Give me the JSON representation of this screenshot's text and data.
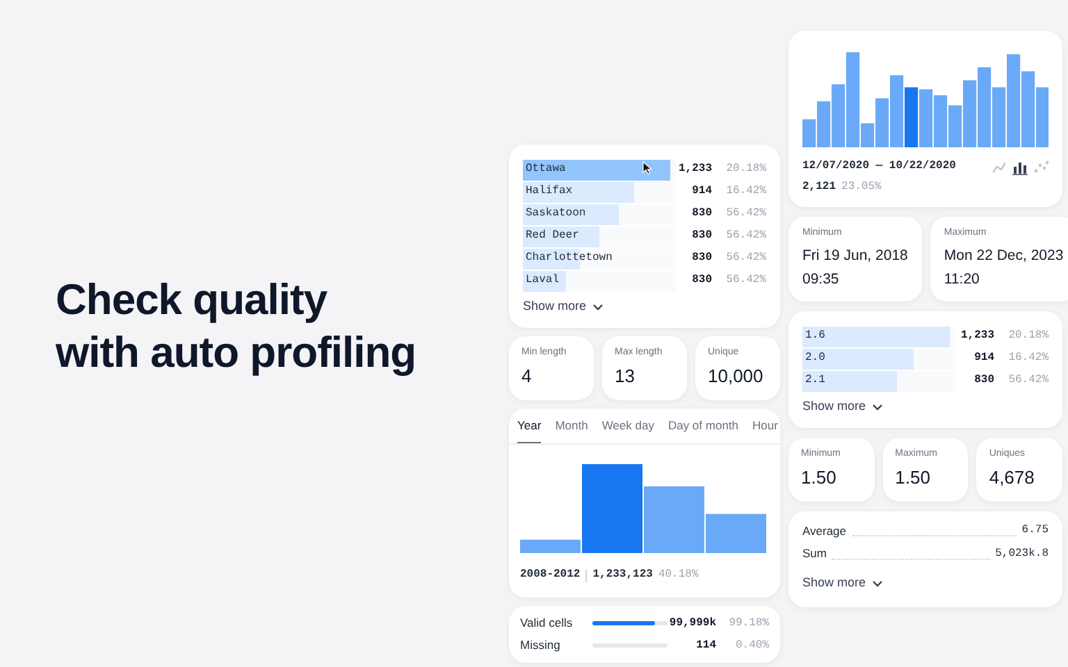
{
  "headline": "Check quality with auto profiling",
  "category_card": {
    "rows": [
      {
        "label": "Ottawa",
        "count": "1,233",
        "percent": "20.18%",
        "level": 0.96,
        "selected": true
      },
      {
        "label": "Halifax",
        "count": "914",
        "percent": "16.42%",
        "level": 0.73,
        "selected": false
      },
      {
        "label": "Saskatoon",
        "count": "830",
        "percent": "56.42%",
        "level": 0.63,
        "selected": false
      },
      {
        "label": "Red Deer",
        "count": "830",
        "percent": "56.42%",
        "level": 0.5,
        "selected": false
      },
      {
        "label": "Charlottetown",
        "count": "830",
        "percent": "56.42%",
        "level": 0.37,
        "selected": false
      },
      {
        "label": "Laval",
        "count": "830",
        "percent": "56.42%",
        "level": 0.28,
        "selected": false
      }
    ],
    "show_more": "Show more"
  },
  "text_stats": [
    {
      "label": "Min length",
      "value": "4"
    },
    {
      "label": "Max length",
      "value": "13"
    },
    {
      "label": "Unique",
      "value": "10,000"
    }
  ],
  "date_histogram": {
    "tabs": [
      {
        "label": "Year",
        "selected": true
      },
      {
        "label": "Month",
        "selected": false
      },
      {
        "label": "Week day",
        "selected": false
      },
      {
        "label": "Day of month",
        "selected": false
      },
      {
        "label": "Hour",
        "selected": false
      }
    ],
    "range": "2008-2012",
    "count": "1,233,123",
    "percent": "40.18%"
  },
  "validity": [
    {
      "label": "Valid cells",
      "count": "99,999k",
      "percent": "99.18%",
      "level": 0.83
    },
    {
      "label": "Missing",
      "count": "114",
      "percent": "0.40%",
      "level": 0
    }
  ],
  "timeline": {
    "range": "12/07/2020 — 10/22/2020",
    "count": "2,121",
    "percent": "23.05%",
    "views": [
      {
        "kind": "line",
        "selected": false
      },
      {
        "kind": "bar",
        "selected": true
      },
      {
        "kind": "scatter",
        "selected": false
      }
    ]
  },
  "date_stats": [
    {
      "label": "Minimum",
      "value": "Fri 19 Jun, 2018",
      "time": "09:35"
    },
    {
      "label": "Maximum",
      "value": "Mon 22 Dec, 2023",
      "time": "11:20"
    }
  ],
  "number_card": {
    "rows": [
      {
        "label": "1.6",
        "count": "1,233",
        "percent": "20.18%",
        "level": 0.96
      },
      {
        "label": "2.0",
        "count": "914",
        "percent": "16.42%",
        "level": 0.73
      },
      {
        "label": "2.1",
        "count": "830",
        "percent": "56.42%",
        "level": 0.62
      }
    ],
    "show_more": "Show more"
  },
  "number_stats": [
    {
      "label": "Minimum",
      "value": "1.50"
    },
    {
      "label": "Maximum",
      "value": "1.50"
    },
    {
      "label": "Uniques",
      "value": "4,678"
    }
  ],
  "summary": {
    "rows": [
      {
        "label": "Average",
        "value": "6.75"
      },
      {
        "label": "Sum",
        "value": "5,023k.8"
      }
    ],
    "show_more": "Show more"
  }
}
